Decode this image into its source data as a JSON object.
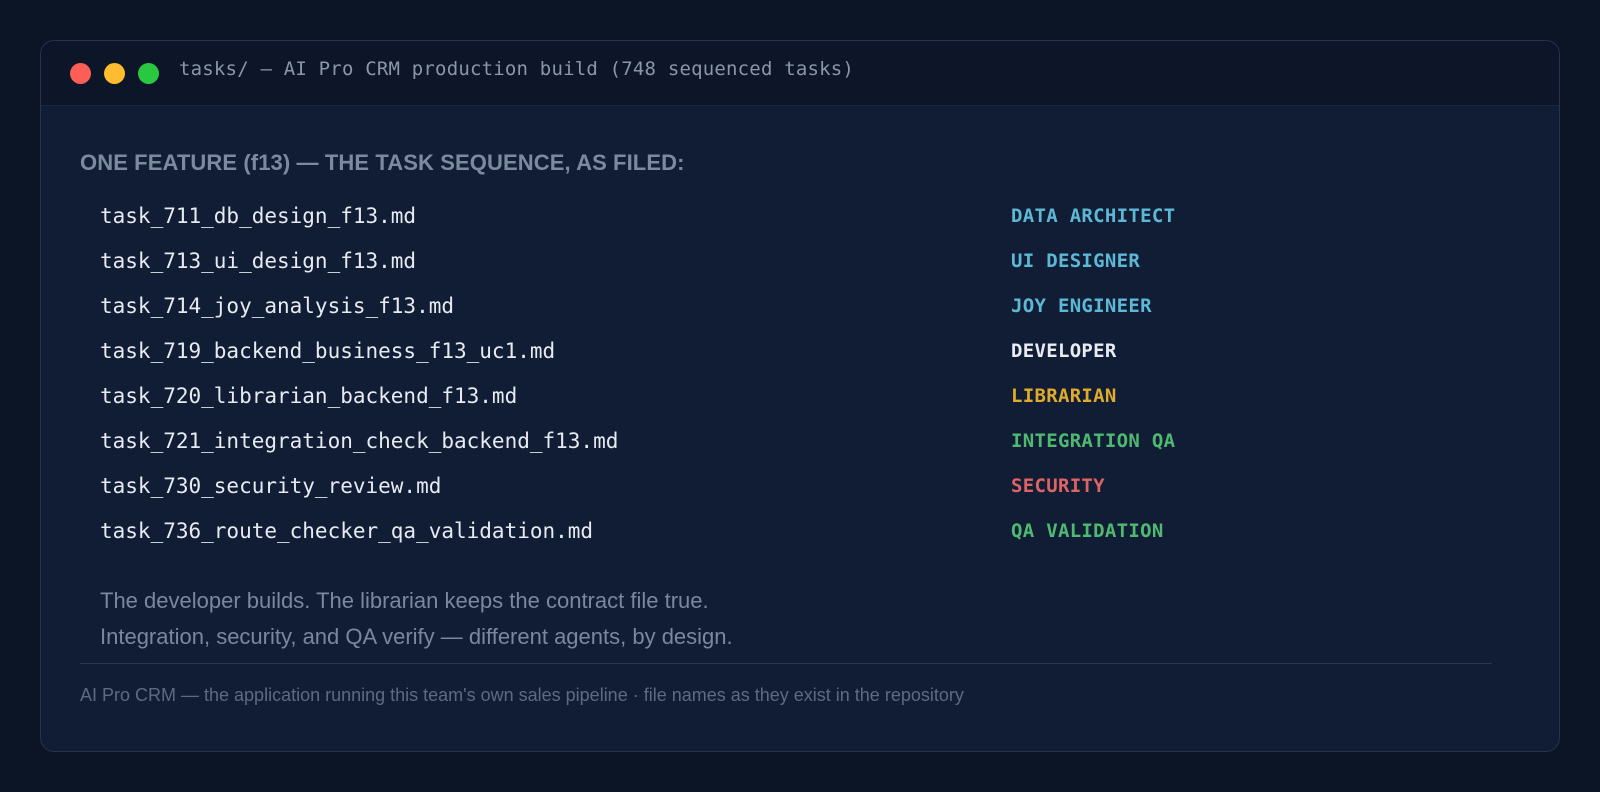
{
  "window": {
    "title": "tasks/ — AI Pro CRM production build (748 sequenced tasks)"
  },
  "content": {
    "heading": "ONE FEATURE (f13) — THE TASK SEQUENCE, AS FILED:",
    "tasks": [
      {
        "file": "task_711_db_design_f13.md",
        "role": "DATA ARCHITECT",
        "role_color": "#5db8d6"
      },
      {
        "file": "task_713_ui_design_f13.md",
        "role": "UI DESIGNER",
        "role_color": "#5db8d6"
      },
      {
        "file": "task_714_joy_analysis_f13.md",
        "role": "JOY ENGINEER",
        "role_color": "#5db8d6"
      },
      {
        "file": "task_719_backend_business_f13_uc1.md",
        "role": "DEVELOPER",
        "role_color": "#e8edf4"
      },
      {
        "file": "task_720_librarian_backend_f13.md",
        "role": "LIBRARIAN",
        "role_color": "#e0aa2a"
      },
      {
        "file": "task_721_integration_check_backend_f13.md",
        "role": "INTEGRATION QA",
        "role_color": "#4fb871"
      },
      {
        "file": "task_730_security_review.md",
        "role": "SECURITY",
        "role_color": "#dc6464"
      },
      {
        "file": "task_736_route_checker_qa_validation.md",
        "role": "QA VALIDATION",
        "role_color": "#4fb871"
      }
    ],
    "note_lines": [
      "The developer builds. The librarian keeps the contract file true.",
      "Integration, security, and QA verify — different agents, by design."
    ],
    "footer": "AI Pro CRM — the application running this team's own sales pipeline · file names as they exist in the repository"
  },
  "colors": {
    "background": "#0c1526",
    "window": "#111d34",
    "titlebar": "#0d1628",
    "dot_red": "#fd5f57",
    "dot_yellow": "#febc2e",
    "dot_green": "#29c840"
  }
}
